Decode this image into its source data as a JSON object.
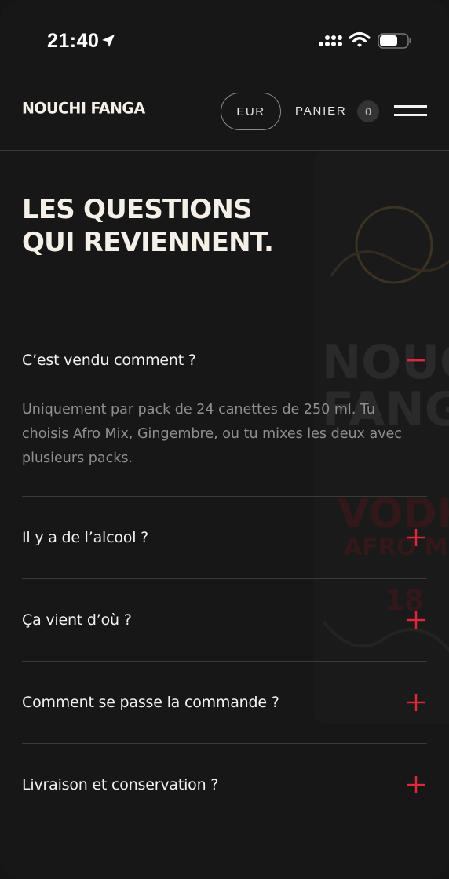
{
  "status_bar": {
    "time": "21:40",
    "icons": [
      "location-arrow-icon",
      "signal-icon",
      "wifi-icon",
      "battery-icon"
    ]
  },
  "header": {
    "brand": "NOUCHI FANGA",
    "currency": "EUR",
    "cart_label": "PANIER",
    "cart_count": "0",
    "menu_icon": "hamburger-menu-icon"
  },
  "faq": {
    "title_line1": "LES QUESTIONS",
    "title_line2": "QUI REVIENNENT.",
    "items": [
      {
        "question": "C’est vendu comment ?",
        "expanded": true,
        "answer": "Uniquement par pack de 24 canettes de 250 ml. Tu choisis Afro Mix, Gingembre, ou tu mixes les deux avec plusieurs packs."
      },
      {
        "question": "Il y a de l’alcool ?",
        "expanded": false
      },
      {
        "question": "Ça vient d’où ?",
        "expanded": false
      },
      {
        "question": "Comment se passe la commande ?",
        "expanded": false
      },
      {
        "question": "Livraison et conservation ?",
        "expanded": false
      }
    ]
  },
  "background_can": {
    "brand_text_top": "NOUCHI",
    "brand_text_bottom": "FANGA",
    "product_text": "VODKA",
    "flavor_text": "AFRO MIX",
    "age_text": "18"
  },
  "colors": {
    "background": "#171717",
    "accent_red": "#e0283a",
    "text_primary": "#f2f2f2",
    "text_muted": "#8f8f8f",
    "divider": "#3a3a3a"
  }
}
